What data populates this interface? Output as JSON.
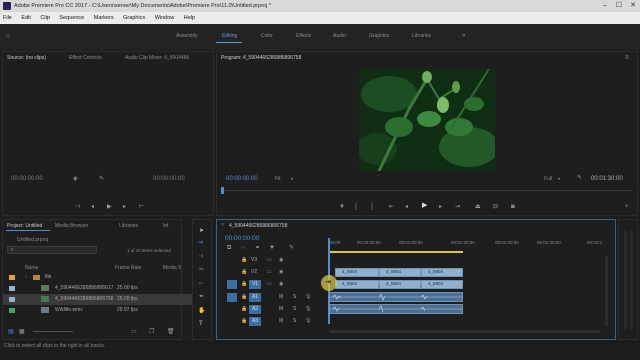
{
  "window": {
    "title": "Adobe Premiere Pro CC 2017 - C:\\Users\\server\\My Documents\\Adobe\\Premiere Pro\\11.0\\Untitled.prproj *",
    "minimize": "–",
    "maximize": "☐",
    "close": "✕"
  },
  "menu": [
    "File",
    "Edit",
    "Clip",
    "Sequence",
    "Markers",
    "Graphics",
    "Window",
    "Help"
  ],
  "workspaces": [
    "Assembly",
    "Editing",
    "Color",
    "Effects",
    "Audio",
    "Graphics",
    "Libraries"
  ],
  "workspace_active": "Editing",
  "source_panel": {
    "tabs": [
      "Source: (no clips)",
      "Effect Controls",
      "Audio Clip Mixer: 4_5904466"
    ],
    "timecode_left": "00:00:00:00",
    "timecode_right": "00:00:00:00"
  },
  "program_panel": {
    "title": "Program: 4_5904466286886806758",
    "timecode": "00:00:00:00",
    "fit": "Fit",
    "quality": "Full",
    "duration": "00:01:30:00"
  },
  "project_panel": {
    "tabs": [
      "Project: Untitled",
      "Media Browser",
      "Libraries",
      "Inf"
    ],
    "project_file": "Untitled.prproj",
    "items_selected": "1 of 10 items selected",
    "columns": {
      "name": "Name",
      "frame_rate": "Frame Rate",
      "media_start": "Media S"
    },
    "rows": [
      {
        "name": "file",
        "frame_rate": "",
        "type": "folder"
      },
      {
        "name": "4_5904466286886806617",
        "frame_rate": "25.00 fps",
        "type": "clip"
      },
      {
        "name": "4_5904466286886806758",
        "frame_rate": "25.00 fps",
        "type": "clip"
      },
      {
        "name": "Wildlife.wmv",
        "frame_rate": "29.97 fps",
        "type": "clip"
      }
    ]
  },
  "timeline": {
    "sequence_tab": "4_5904466286886806758",
    "timecode": "00:00:00:00",
    "ruler": [
      "00:00",
      "00:00:30:00",
      "00:01:00:00",
      "00:01:30:00",
      "00:02:00:00",
      "00:02:30:00",
      "00:03:0"
    ],
    "video_tracks": [
      "V3",
      "V2",
      "V1"
    ],
    "audio_tracks": [
      "A1",
      "A2",
      "A3"
    ],
    "mute_label": "M",
    "solo_label": "S",
    "v2_clips": [
      "4_5904",
      "4_5904",
      "4_5904"
    ],
    "v1_clips": [
      "4_5904",
      "4_5904",
      "4_5904"
    ]
  },
  "status_bar": "Click to select all clips to the right in all tracks.",
  "colors": {
    "accent": "#4c8fd6",
    "playhead": "#5a9ddb",
    "video_clip": "#8fb1cf",
    "audio_clip": "#4a6f93"
  }
}
